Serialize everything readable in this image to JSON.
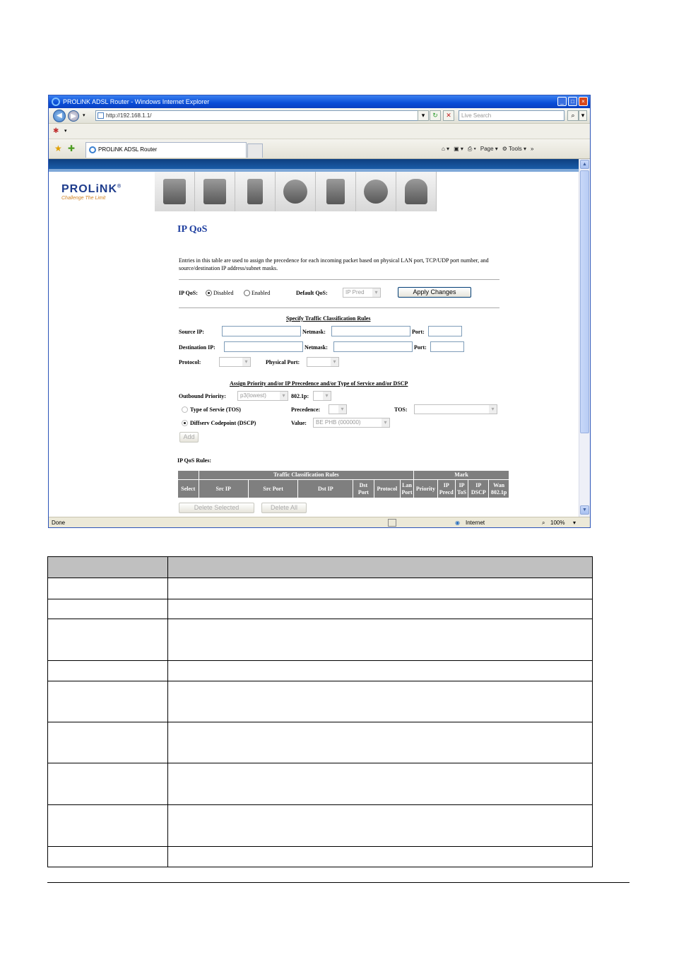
{
  "browser": {
    "title": "PROLiNK ADSL Router - Windows Internet Explorer",
    "address": "http://192.168.1.1/",
    "search_placeholder": "Live Search",
    "tab_label": "PROLiNK ADSL Router",
    "commands": {
      "page": "Page",
      "tools": "Tools"
    },
    "status": {
      "left": "Done",
      "zone": "Internet",
      "zoom": "100%"
    }
  },
  "router": {
    "logo": "PROLiNK",
    "logo_mark": "®",
    "tagline": "Challenge The Limit"
  },
  "page": {
    "title": "IP QoS",
    "intro": "Entries in this table are used to assign the precedence for each incoming packet based on physical LAN port, TCP/UDP port number, and source/destination IP address/subnet masks.",
    "ipqos_label": "IP QoS:",
    "disabled_label": "Disabled",
    "enabled_label": "Enabled",
    "default_qos_label": "Default QoS:",
    "default_qos_value": "IP Pred",
    "apply_label": "Apply Changes",
    "classification_heading": "Specify Traffic Classification Rules",
    "source_ip_label": "Source IP:",
    "netmask_label": "Netmask:",
    "port_label": "Port:",
    "destination_ip_label": "Destination IP:",
    "protocol_label": "Protocol:",
    "physical_port_label": "Physical Port:",
    "assign_heading": "Assign Priority and/or IP Precedence and/or Type of Service and/or DSCP",
    "outbound_priority_label": "Outbound Priority:",
    "outbound_priority_value": "p3(lowest)",
    "dot1p_label": "802.1p:",
    "tos_option_label": "Type of Servie (TOS)",
    "precedence_label": "Precedence:",
    "tos_label": "TOS:",
    "dscp_option_label": "Diffserv Codepoint (DSCP)",
    "value_label": "Value:",
    "value_value": "BE PHB (000000)",
    "add_label": "Add",
    "rules_label": "IP QoS Rules:",
    "table": {
      "group_classification": "Traffic Classification Rules",
      "group_mark": "Mark",
      "columns": [
        "Select",
        "Src IP",
        "Src Port",
        "Dst IP",
        "Dst Port",
        "Protocol",
        "Lan Port",
        "Priority",
        "IP Precd",
        "IP ToS",
        "IP DSCP",
        "Wan 802.1p"
      ]
    },
    "delete_selected_label": "Delete Selected",
    "delete_all_label": "Delete All"
  }
}
